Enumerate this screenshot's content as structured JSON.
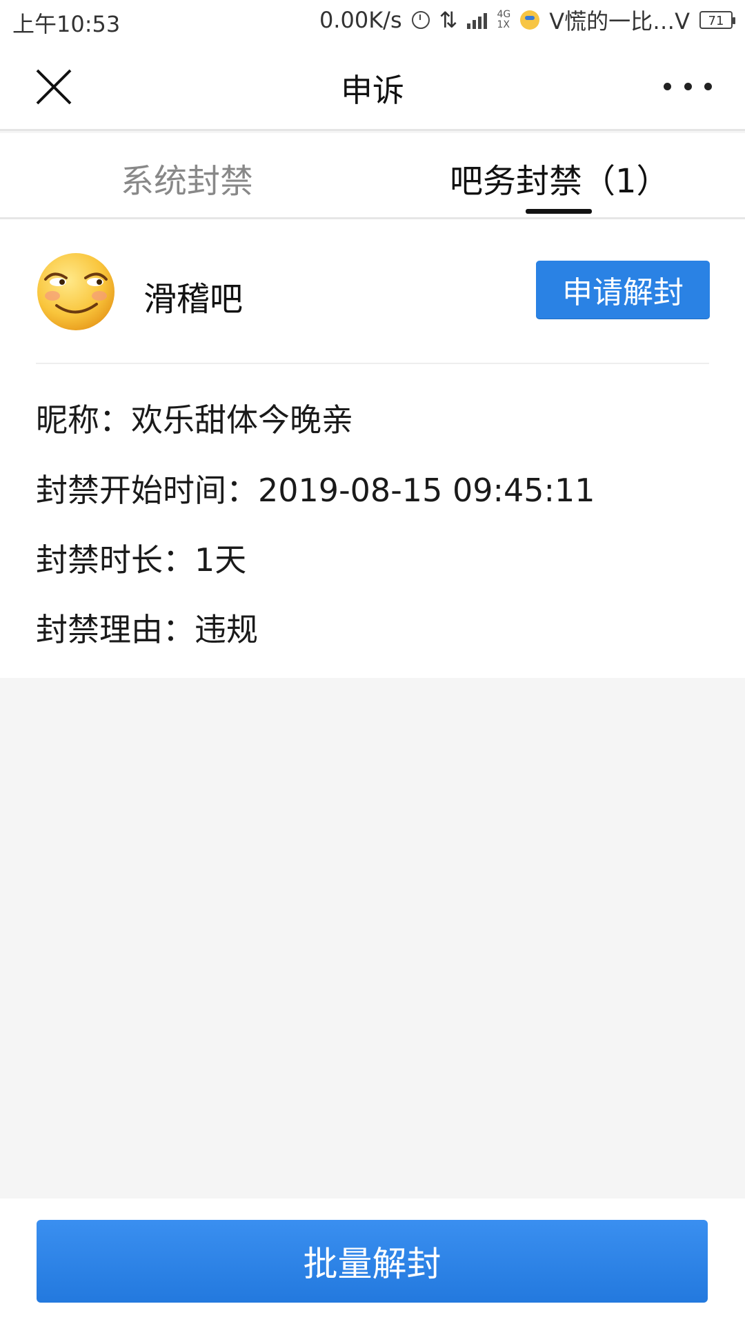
{
  "status_bar": {
    "time": "上午10:53",
    "net_speed": "0.00K/s",
    "network_top": "4G",
    "network_bottom": "1X",
    "carrier": "V慌的一比…V",
    "battery": "71"
  },
  "header": {
    "title": "申诉",
    "close_icon": "close-icon",
    "more_icon": "more-icon"
  },
  "tabs": [
    {
      "label": "系统封禁",
      "active": false
    },
    {
      "label": "吧务封禁（1）",
      "active": true
    }
  ],
  "ban_record": {
    "forum_name": "滑稽吧",
    "avatar_icon": "funny-face-icon",
    "apply_button": "申请解封",
    "nickname": "昵称：欢乐甜体今晚亲",
    "start_time": "封禁开始时间：2019-08-15 09:45:11",
    "duration": "封禁时长：1天",
    "reason": "封禁理由：违规"
  },
  "footer": {
    "batch_button": "批量解封"
  },
  "colors": {
    "accent": "#2a82e4",
    "page_bg": "#f5f5f5",
    "inactive_tab": "#888888"
  }
}
